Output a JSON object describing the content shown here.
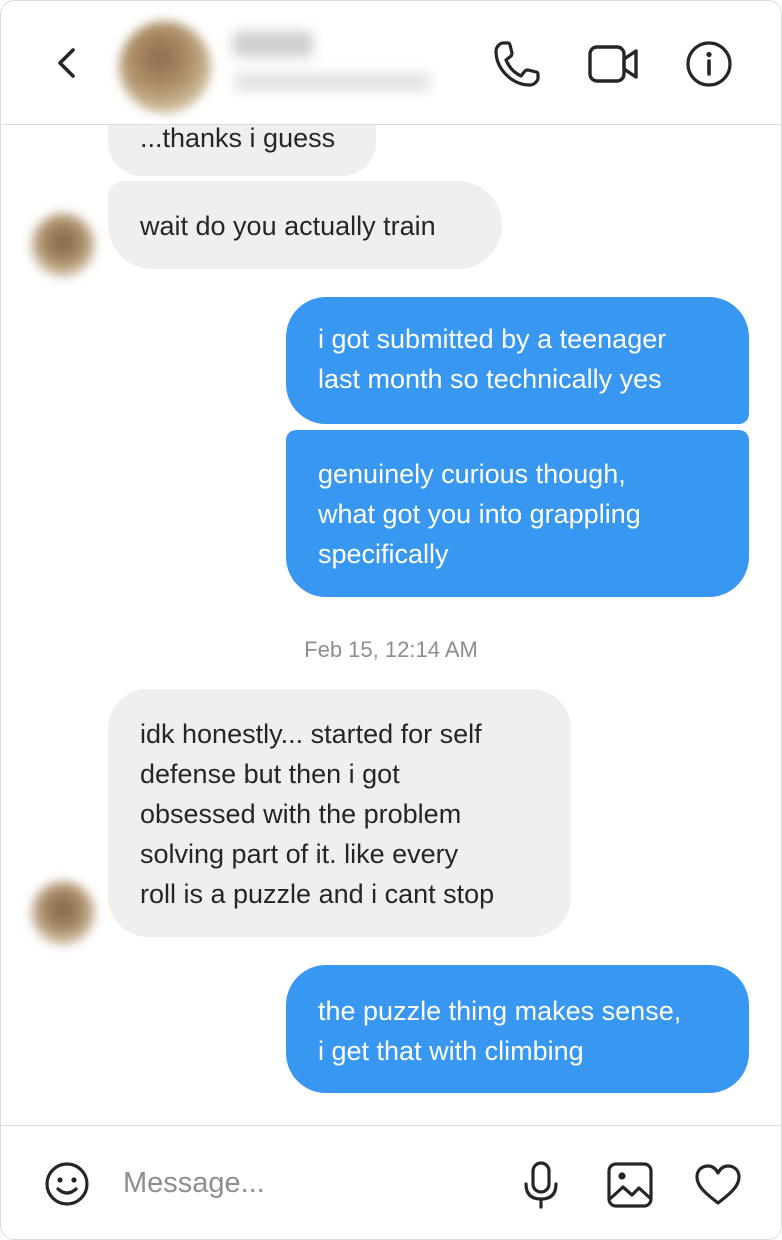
{
  "header": {
    "back_icon": "chevron-left-icon",
    "contact_name": "",
    "contact_status": "",
    "actions": [
      {
        "name": "phone-icon"
      },
      {
        "name": "video-camera-icon"
      },
      {
        "name": "info-icon"
      }
    ]
  },
  "messages": [
    {
      "direction": "incoming",
      "text": "...thanks i guess",
      "show_avatar": false
    },
    {
      "direction": "incoming",
      "text": "wait do you actually train",
      "show_avatar": true
    },
    {
      "direction": "outgoing",
      "text": "i got submitted by a teenager\nlast month so technically yes"
    },
    {
      "direction": "outgoing",
      "text": "genuinely curious though,\nwhat got you into grappling\nspecifically"
    },
    {
      "direction": "incoming",
      "text": "idk honestly... started for self\ndefense but then i got\nobsessed with the problem\nsolving part of it. like every\nroll is a puzzle and i cant stop",
      "show_avatar": true
    },
    {
      "direction": "outgoing",
      "text": "the puzzle thing makes sense,\ni get that with climbing"
    }
  ],
  "timestamp": "Feb 15, 12:14 AM",
  "composer": {
    "placeholder": "Message...",
    "value": "",
    "icons": [
      "smiley-icon",
      "microphone-icon",
      "image-icon",
      "heart-icon"
    ]
  },
  "colors": {
    "outgoing_bubble": "#3897f0",
    "incoming_bubble": "#efefef",
    "border": "#dbdbdb",
    "secondary_text": "#8e8e8e"
  }
}
